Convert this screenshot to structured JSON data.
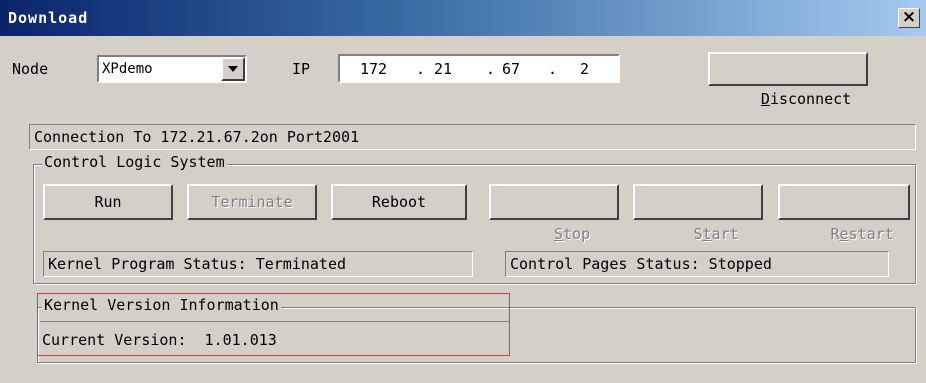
{
  "window": {
    "title": "Download",
    "close_label": "×"
  },
  "top_row": {
    "node_label": "Node",
    "node_value": "XPdemo",
    "ip_label": "IP",
    "ip": [
      "172",
      "21",
      "67",
      "2"
    ],
    "ip_dot": ".",
    "disconnect_button": {
      "pre": "",
      "accel": "D",
      "post": "isconnect"
    }
  },
  "connection_status": "Connection To 172.21.67.2on Port2001",
  "control_logic": {
    "group_title": "Control Logic System",
    "buttons": {
      "run": "Run",
      "terminate": "Terminate",
      "reboot": "Reboot",
      "stop": {
        "pre": "",
        "accel": "S",
        "post": "top"
      },
      "start": {
        "pre": "S",
        "accel": "t",
        "post": "art"
      },
      "restart": {
        "pre": "R",
        "accel": "e",
        "post": "start"
      }
    },
    "kernel_status": "Kernel Program Status: Terminated",
    "pages_status": "Control Pages Status: Stopped"
  },
  "kernel_version": {
    "group_title": "Kernel Version Information",
    "current_version": "Current Version:  1.01.013"
  }
}
